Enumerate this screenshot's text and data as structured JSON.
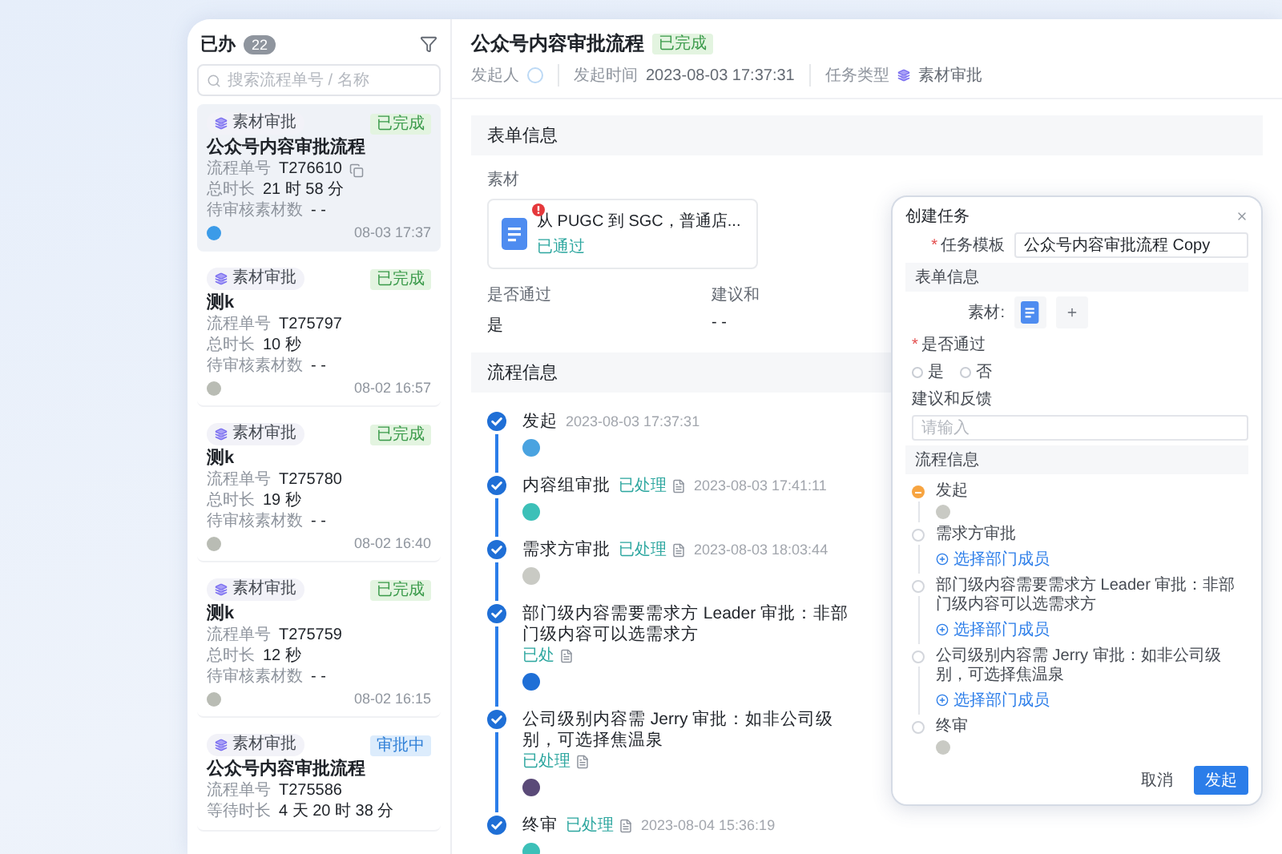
{
  "sidebar": {
    "title": "已办",
    "count": "22",
    "search": {
      "placeholder": "搜索流程单号 / 名称"
    },
    "cards": [
      {
        "selected": true,
        "tag": "素材审批",
        "status": {
          "label": "已完成",
          "kind": "done"
        },
        "title": "公众号内容审批流程",
        "rows": [
          {
            "label": "流程单号",
            "value": "T276610",
            "copy": true
          },
          {
            "label": "总时长",
            "value": "21 时 58 分",
            "copy": false
          },
          {
            "label": "待审核素材数",
            "value": "- -",
            "copy": false
          }
        ],
        "avatar": {
          "color": "#3b9be8"
        },
        "time": "08-03 17:37"
      },
      {
        "selected": false,
        "tag": "素材审批",
        "status": {
          "label": "已完成",
          "kind": "done"
        },
        "title": "测k",
        "rows": [
          {
            "label": "流程单号",
            "value": "T275797",
            "copy": false
          },
          {
            "label": "总时长",
            "value": "10 秒",
            "copy": false
          },
          {
            "label": "待审核素材数",
            "value": "- -",
            "copy": false
          }
        ],
        "avatar": {
          "color": "#b9bcb4"
        },
        "time": "08-02 16:57"
      },
      {
        "selected": false,
        "tag": "素材审批",
        "status": {
          "label": "已完成",
          "kind": "done"
        },
        "title": "测k",
        "rows": [
          {
            "label": "流程单号",
            "value": "T275780",
            "copy": false
          },
          {
            "label": "总时长",
            "value": "19 秒",
            "copy": false
          },
          {
            "label": "待审核素材数",
            "value": "- -",
            "copy": false
          }
        ],
        "avatar": {
          "color": "#b9bcb4"
        },
        "time": "08-02 16:40"
      },
      {
        "selected": false,
        "tag": "素材审批",
        "status": {
          "label": "已完成",
          "kind": "done"
        },
        "title": "测k",
        "rows": [
          {
            "label": "流程单号",
            "value": "T275759",
            "copy": false
          },
          {
            "label": "总时长",
            "value": "12 秒",
            "copy": false
          },
          {
            "label": "待审核素材数",
            "value": "- -",
            "copy": false
          }
        ],
        "avatar": {
          "color": "#b9bcb4"
        },
        "time": "08-02 16:15"
      },
      {
        "selected": false,
        "tag": "素材审批",
        "status": {
          "label": "审批中",
          "kind": "pending"
        },
        "title": "公众号内容审批流程",
        "rows": [
          {
            "label": "流程单号",
            "value": "T275586",
            "copy": false
          },
          {
            "label": "等待时长",
            "value": "4 天 20 时 38 分",
            "copy": false
          }
        ]
      }
    ]
  },
  "detail": {
    "title": "公众号内容审批流程",
    "status": {
      "label": "已完成",
      "kind": "done"
    },
    "meta": [
      {
        "kind": "person",
        "label": "发起人"
      },
      {
        "kind": "text",
        "label": "发起时间",
        "value": "2023-08-03 17:37:31"
      },
      {
        "kind": "tag",
        "label": "任务类型",
        "value": "素材审批"
      }
    ],
    "form": {
      "heading": "表单信息",
      "material": {
        "label": "素材",
        "file": {
          "name": "从 PUGC 到 SGC，普通店...",
          "status": "已通过",
          "alert": true
        }
      },
      "fields": [
        {
          "label": "是否通过",
          "value": "是"
        },
        {
          "label": "建议和",
          "value": "- -"
        }
      ]
    },
    "process": {
      "heading": "流程信息",
      "steps": [
        {
          "title": "发起",
          "time": "2023-08-03 17:37:31",
          "avatar": {
            "color": "#4aa3e0"
          }
        },
        {
          "title": "内容组审批",
          "status": "已处理",
          "time": "2023-08-03 17:41:11",
          "avatar": {
            "color": "#3cc0b8"
          }
        },
        {
          "title": "需求方审批",
          "status": "已处理",
          "time": "2023-08-03 18:03:44",
          "avatar": {
            "color": "#c9cac4"
          }
        },
        {
          "title": "部门级内容需要需求方 Leader 审批：非部门级内容可以选需求方",
          "status": "已处",
          "avatar": {
            "color": "#1f6fd6"
          }
        },
        {
          "title": "公司级别内容需 Jerry 审批：如非公司级别，可选择焦温泉",
          "status": "已处理",
          "avatar": {
            "color": "#5a4a78"
          }
        },
        {
          "title": "终审",
          "status": "已处理",
          "time": "2023-08-04 15:36:19",
          "avatar": {
            "color": "#3cc0b8"
          }
        }
      ]
    }
  },
  "dialog": {
    "title": "创建任务",
    "template": {
      "required_mark": "*",
      "label": "任务模板",
      "value": "公众号内容审批流程 Copy"
    },
    "form_heading": "表单信息",
    "material_label": "素材:",
    "pass_field": {
      "required_mark": "*",
      "label": "是否通过",
      "options": [
        {
          "label": "是",
          "selected": false
        },
        {
          "label": "否",
          "selected": false
        }
      ]
    },
    "feedback": {
      "label": "建议和反馈",
      "placeholder": "请输入"
    },
    "process_heading": "流程信息",
    "steps": [
      {
        "title": "发起",
        "current": true,
        "kind": "avatar"
      },
      {
        "title": "需求方审批",
        "current": false,
        "kind": "picker",
        "action": "选择部门成员"
      },
      {
        "title": "部门级内容需要需求方 Leader 审批：非部门级内容可以选需求方",
        "current": false,
        "kind": "picker",
        "action": "选择部门成员"
      },
      {
        "title": "公司级别内容需 Jerry 审批：如非公司级别，可选择焦温泉",
        "current": false,
        "kind": "picker",
        "action": "选择部门成员"
      },
      {
        "title": "终审",
        "current": false,
        "kind": "avatar"
      }
    ],
    "buttons": [
      {
        "label": "取消",
        "kind": "secondary"
      },
      {
        "label": "发起",
        "kind": "primary"
      }
    ]
  }
}
